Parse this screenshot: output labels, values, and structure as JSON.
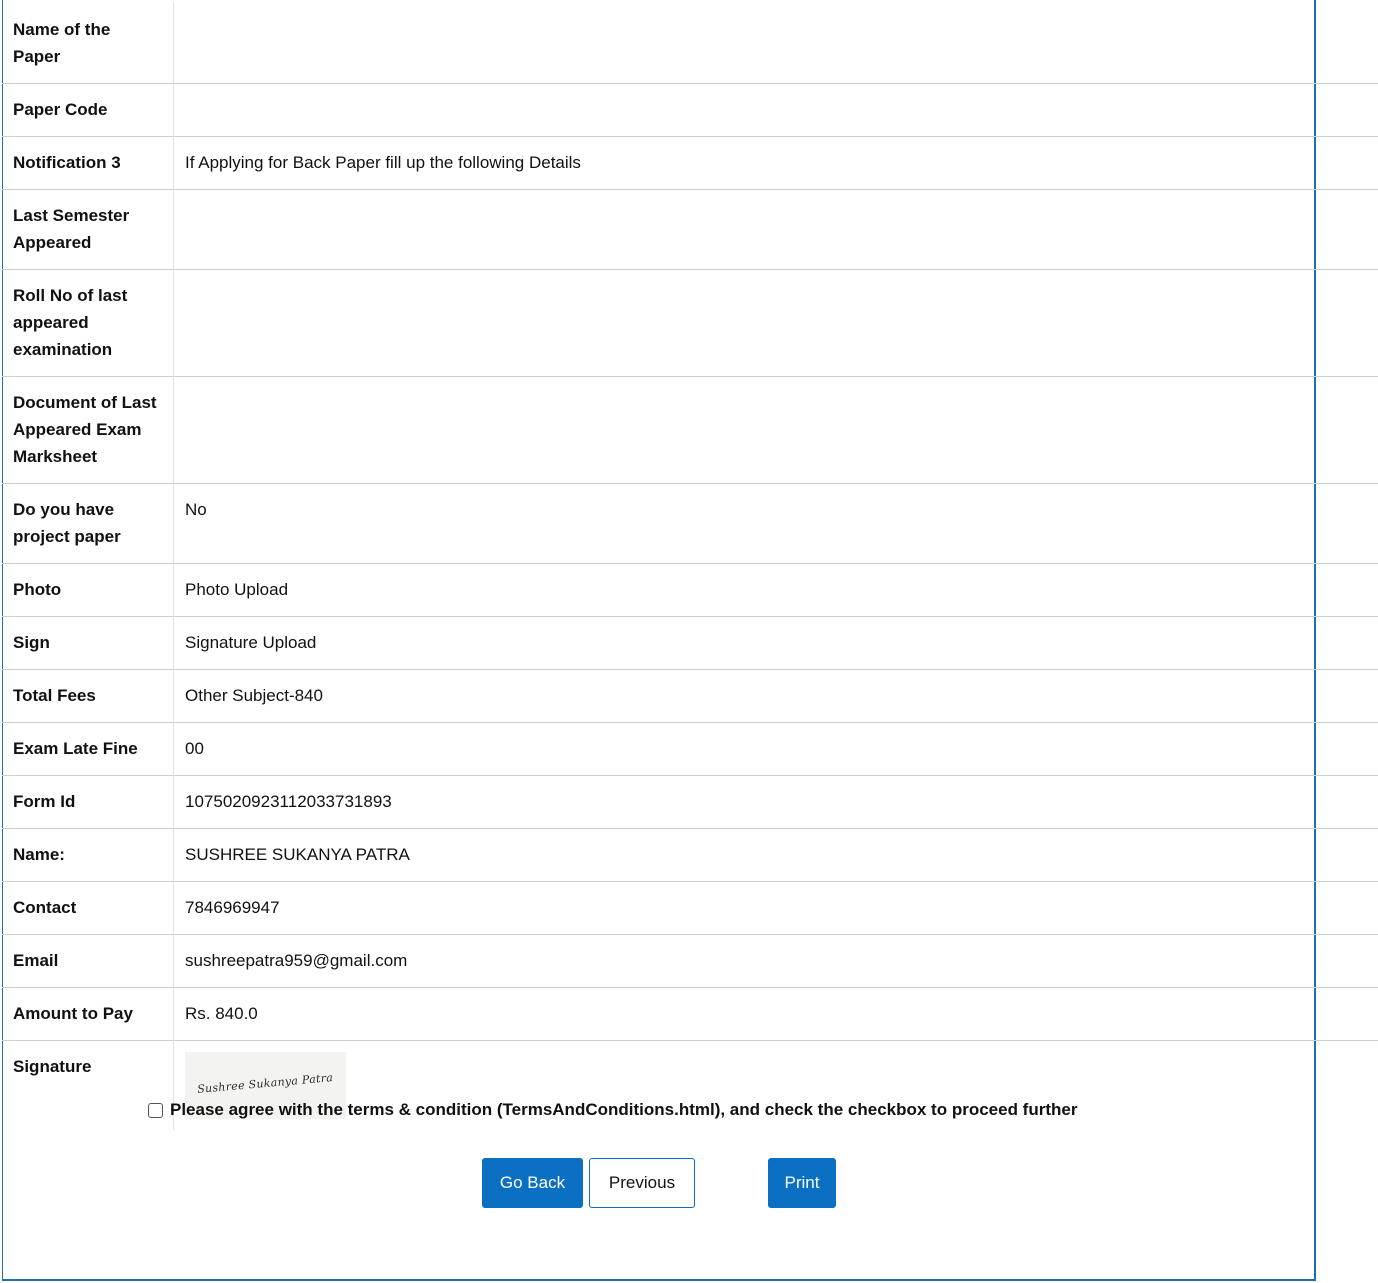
{
  "rows": [
    {
      "label": "Name of the Paper",
      "value": ""
    },
    {
      "label": "Paper Code",
      "value": ""
    },
    {
      "label": "Notification 3",
      "value": "If Applying for Back Paper fill up the following Details"
    },
    {
      "label": "Last Semester Appeared",
      "value": ""
    },
    {
      "label": "Roll No of last appeared examination",
      "value": ""
    },
    {
      "label": "Document of Last Appeared Exam Marksheet",
      "value": ""
    },
    {
      "label": "Do you have project paper",
      "value": "No"
    },
    {
      "label": "Photo",
      "value": "Photo Upload"
    },
    {
      "label": "Sign",
      "value": "Signature Upload"
    },
    {
      "label": "Total Fees",
      "value": "Other Subject-840"
    },
    {
      "label": "Exam Late Fine",
      "value": "00"
    },
    {
      "label": "Form Id",
      "value": "10750209231120337318 93"
    },
    {
      "label": "Name:",
      "value": "SUSHREE SUKANYA PATRA"
    },
    {
      "label": "Contact",
      "value": "7846969947"
    },
    {
      "label": "Email",
      "value": "sushreepatra959@gmail.com"
    },
    {
      "label": "Amount to Pay",
      "value": "Rs. 840.0"
    },
    {
      "label": "Signature",
      "value": ""
    }
  ],
  "signature_text": "Sushree Sukanya Patra",
  "agree_text": "Please agree with the terms & condition (TermsAndConditions.html), and check the checkbox to proceed further",
  "buttons": {
    "go_back": "Go Back",
    "previous": "Previous",
    "print": "Print"
  },
  "colors": {
    "primary": "#0b6fc2",
    "frame": "#1f6fae"
  }
}
